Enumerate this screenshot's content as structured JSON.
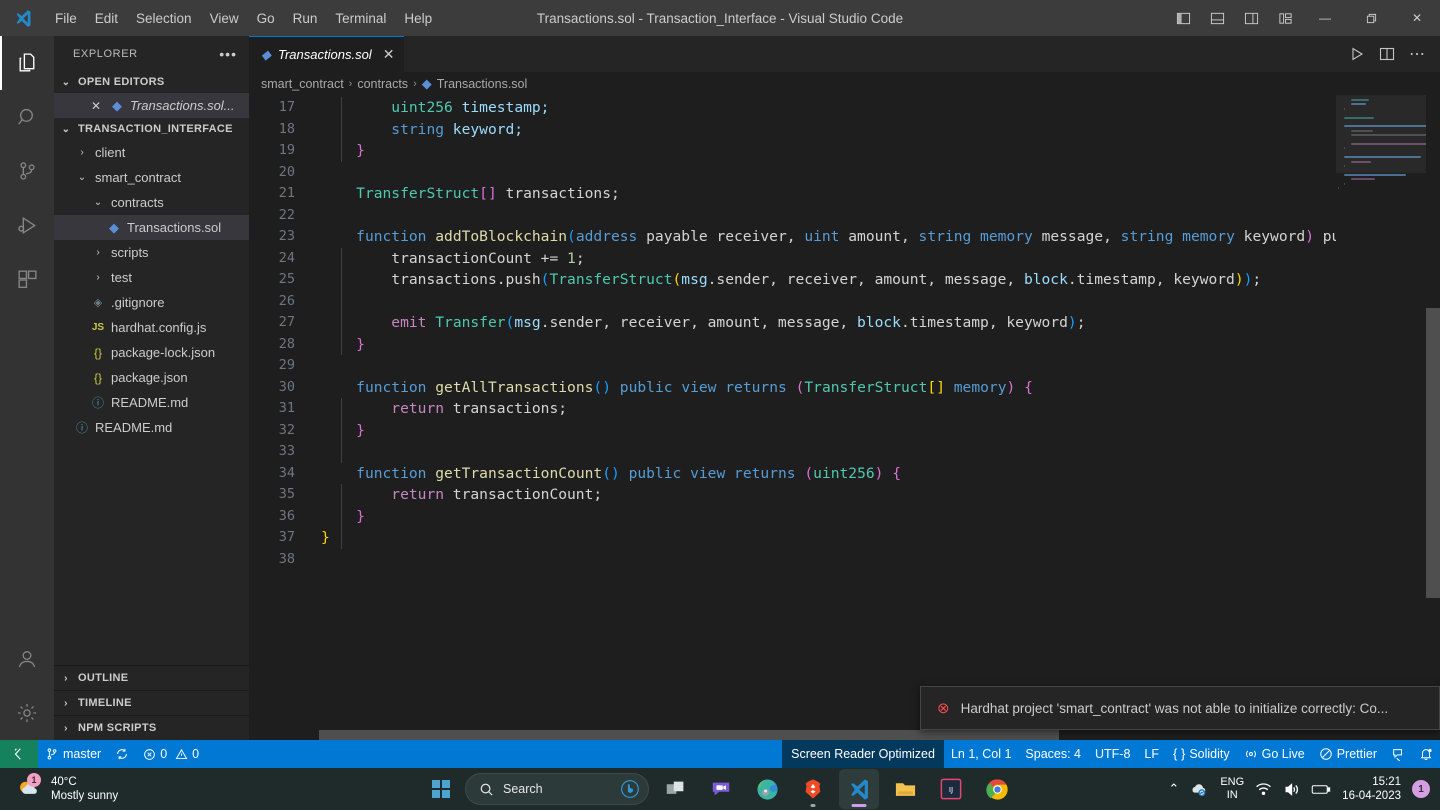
{
  "window": {
    "title": "Transactions.sol - Transaction_Interface - Visual Studio Code",
    "menus": [
      "File",
      "Edit",
      "Selection",
      "View",
      "Go",
      "Run",
      "Terminal",
      "Help"
    ],
    "layout_buttons": [
      "toggle-primary-sidebar",
      "toggle-panel",
      "toggle-secondary-sidebar",
      "customize-layout"
    ],
    "controls": {
      "minimize": "—",
      "restore": "❐",
      "close": "✕"
    }
  },
  "activity_bar": {
    "items": [
      {
        "name": "explorer",
        "icon": "files-icon",
        "active": true
      },
      {
        "name": "search",
        "icon": "search-icon",
        "active": false
      },
      {
        "name": "source-control",
        "icon": "source-control-icon",
        "active": false
      },
      {
        "name": "run-and-debug",
        "icon": "debug-icon",
        "active": false
      },
      {
        "name": "extensions",
        "icon": "extensions-icon",
        "active": false
      }
    ],
    "bottom": [
      {
        "name": "accounts",
        "icon": "account-icon"
      },
      {
        "name": "manage",
        "icon": "gear-icon"
      }
    ]
  },
  "sidebar": {
    "header": "EXPLORER",
    "more_actions": "•••",
    "open_editors": {
      "title": "OPEN EDITORS",
      "items": [
        {
          "label": "Transactions.sol...",
          "icon": "solidity-icon",
          "close": "✕",
          "selected": true
        }
      ]
    },
    "project": {
      "title": "TRANSACTION_INTERFACE",
      "items": [
        {
          "label": "client",
          "icon": "folder-icon",
          "type": "folder",
          "expanded": false,
          "indent": 1
        },
        {
          "label": "smart_contract",
          "icon": "folder-icon",
          "type": "folder",
          "expanded": true,
          "indent": 1
        },
        {
          "label": "contracts",
          "icon": "folder-icon",
          "type": "folder",
          "expanded": true,
          "indent": 2
        },
        {
          "label": "Transactions.sol",
          "icon": "solidity-icon",
          "type": "file",
          "selected": true,
          "indent": 3
        },
        {
          "label": "scripts",
          "icon": "folder-icon",
          "type": "folder",
          "expanded": false,
          "indent": 2
        },
        {
          "label": "test",
          "icon": "folder-icon",
          "type": "folder",
          "expanded": false,
          "indent": 2
        },
        {
          "label": ".gitignore",
          "icon": "gitignore-icon",
          "type": "file",
          "indent": 2
        },
        {
          "label": "hardhat.config.js",
          "icon": "js-icon",
          "type": "file",
          "indent": 2
        },
        {
          "label": "package-lock.json",
          "icon": "json-icon",
          "type": "file",
          "indent": 2
        },
        {
          "label": "package.json",
          "icon": "json-icon",
          "type": "file",
          "indent": 2
        },
        {
          "label": "README.md",
          "icon": "markdown-icon",
          "type": "file",
          "indent": 2
        },
        {
          "label": "README.md",
          "icon": "markdown-icon",
          "type": "file",
          "indent": 1
        }
      ]
    },
    "bottom_sections": [
      "OUTLINE",
      "TIMELINE",
      "NPM SCRIPTS"
    ]
  },
  "editor": {
    "tab": {
      "label": "Transactions.sol",
      "icon": "solidity-icon",
      "close": "✕",
      "dirty": false
    },
    "tab_actions": [
      "run-button",
      "split-editor-button",
      "more-actions-button"
    ],
    "breadcrumbs": [
      "smart_contract",
      "contracts",
      "Transactions.sol"
    ],
    "first_visible_line": 17,
    "lines": [
      {
        "n": 17,
        "indent": 8,
        "tokens": [
          {
            "t": "uint256",
            "c": "t-type"
          },
          {
            "t": " timestamp;",
            "c": "t-var"
          }
        ]
      },
      {
        "n": 18,
        "indent": 8,
        "tokens": [
          {
            "t": "string",
            "c": "t-kw"
          },
          {
            "t": " keyword;",
            "c": "t-var"
          }
        ]
      },
      {
        "n": 19,
        "indent": 4,
        "tokens": [
          {
            "t": "}",
            "c": "t-brk2"
          }
        ]
      },
      {
        "n": 20,
        "indent": 0,
        "tokens": []
      },
      {
        "n": 21,
        "indent": 4,
        "tokens": [
          {
            "t": "TransferStruct",
            "c": "t-type"
          },
          {
            "t": "[",
            "c": "t-brk2"
          },
          {
            "t": "]",
            "c": "t-brk2"
          },
          {
            "t": " transactions;",
            "c": "t-plain"
          }
        ]
      },
      {
        "n": 22,
        "indent": 0,
        "tokens": []
      },
      {
        "n": 23,
        "indent": 4,
        "tokens": [
          {
            "t": "function",
            "c": "t-kw"
          },
          {
            "t": " ",
            "c": "t-plain"
          },
          {
            "t": "addToBlockchain",
            "c": "t-fn"
          },
          {
            "t": "(",
            "c": "t-brk3"
          },
          {
            "t": "address",
            "c": "t-kw"
          },
          {
            "t": " payable",
            "c": "t-plain"
          },
          {
            "t": " receiver, ",
            "c": "t-plain"
          },
          {
            "t": "uint",
            "c": "t-kw"
          },
          {
            "t": " amount, ",
            "c": "t-plain"
          },
          {
            "t": "string",
            "c": "t-kw"
          },
          {
            "t": " memory",
            "c": "t-kw"
          },
          {
            "t": " message, ",
            "c": "t-plain"
          },
          {
            "t": "string",
            "c": "t-kw"
          },
          {
            "t": " memory",
            "c": "t-kw"
          },
          {
            "t": " keyword",
            "c": "t-plain"
          },
          {
            "t": ")",
            "c": "t-brk2"
          },
          {
            "t": " pub",
            "c": "t-plain"
          }
        ]
      },
      {
        "n": 24,
        "indent": 8,
        "tokens": [
          {
            "t": "transactionCount ",
            "c": "t-plain"
          },
          {
            "t": "+= ",
            "c": "t-plain"
          },
          {
            "t": "1",
            "c": "t-num"
          },
          {
            "t": ";",
            "c": "t-plain"
          }
        ]
      },
      {
        "n": 25,
        "indent": 8,
        "tokens": [
          {
            "t": "transactions",
            "c": "t-plain"
          },
          {
            "t": ".push",
            "c": "t-plain"
          },
          {
            "t": "(",
            "c": "t-brk3"
          },
          {
            "t": "TransferStruct",
            "c": "t-type"
          },
          {
            "t": "(",
            "c": "t-brk1"
          },
          {
            "t": "msg",
            "c": "t-var"
          },
          {
            "t": ".sender, receiver, amount, message, ",
            "c": "t-plain"
          },
          {
            "t": "block",
            "c": "t-var"
          },
          {
            "t": ".timestamp, keyword",
            "c": "t-plain"
          },
          {
            "t": ")",
            "c": "t-brk1"
          },
          {
            "t": ")",
            "c": "t-brk3"
          },
          {
            "t": ";",
            "c": "t-plain"
          }
        ]
      },
      {
        "n": 26,
        "indent": 0,
        "tokens": []
      },
      {
        "n": 27,
        "indent": 8,
        "tokens": [
          {
            "t": "emit",
            "c": "t-pur"
          },
          {
            "t": " ",
            "c": "t-plain"
          },
          {
            "t": "Transfer",
            "c": "t-type"
          },
          {
            "t": "(",
            "c": "t-brk3"
          },
          {
            "t": "msg",
            "c": "t-var"
          },
          {
            "t": ".sender, receiver, amount, message, ",
            "c": "t-plain"
          },
          {
            "t": "block",
            "c": "t-var"
          },
          {
            "t": ".timestamp, keyword",
            "c": "t-plain"
          },
          {
            "t": ")",
            "c": "t-brk3"
          },
          {
            "t": ";",
            "c": "t-plain"
          }
        ]
      },
      {
        "n": 28,
        "indent": 4,
        "tokens": [
          {
            "t": "}",
            "c": "t-brk2"
          }
        ]
      },
      {
        "n": 29,
        "indent": 0,
        "tokens": []
      },
      {
        "n": 30,
        "indent": 4,
        "tokens": [
          {
            "t": "function",
            "c": "t-kw"
          },
          {
            "t": " ",
            "c": "t-plain"
          },
          {
            "t": "getAllTransactions",
            "c": "t-fn"
          },
          {
            "t": "(",
            "c": "t-brk3"
          },
          {
            "t": ")",
            "c": "t-brk3"
          },
          {
            "t": " ",
            "c": "t-plain"
          },
          {
            "t": "public",
            "c": "t-kw"
          },
          {
            "t": " ",
            "c": "t-plain"
          },
          {
            "t": "view",
            "c": "t-kw"
          },
          {
            "t": " ",
            "c": "t-plain"
          },
          {
            "t": "returns",
            "c": "t-kw"
          },
          {
            "t": " ",
            "c": "t-plain"
          },
          {
            "t": "(",
            "c": "t-brk2"
          },
          {
            "t": "TransferStruct",
            "c": "t-type"
          },
          {
            "t": "[",
            "c": "t-brk1"
          },
          {
            "t": "]",
            "c": "t-brk1"
          },
          {
            "t": " memory",
            "c": "t-kw"
          },
          {
            "t": ")",
            "c": "t-brk2"
          },
          {
            "t": " ",
            "c": "t-plain"
          },
          {
            "t": "{",
            "c": "t-brk2"
          }
        ]
      },
      {
        "n": 31,
        "indent": 8,
        "tokens": [
          {
            "t": "return",
            "c": "t-pur"
          },
          {
            "t": " transactions;",
            "c": "t-plain"
          }
        ]
      },
      {
        "n": 32,
        "indent": 4,
        "tokens": [
          {
            "t": "}",
            "c": "t-brk2"
          }
        ]
      },
      {
        "n": 33,
        "indent": 0,
        "tokens": []
      },
      {
        "n": 34,
        "indent": 4,
        "tokens": [
          {
            "t": "function",
            "c": "t-kw"
          },
          {
            "t": " ",
            "c": "t-plain"
          },
          {
            "t": "getTransactionCount",
            "c": "t-fn"
          },
          {
            "t": "(",
            "c": "t-brk3"
          },
          {
            "t": ")",
            "c": "t-brk3"
          },
          {
            "t": " ",
            "c": "t-plain"
          },
          {
            "t": "public",
            "c": "t-kw"
          },
          {
            "t": " ",
            "c": "t-plain"
          },
          {
            "t": "view",
            "c": "t-kw"
          },
          {
            "t": " ",
            "c": "t-plain"
          },
          {
            "t": "returns",
            "c": "t-kw"
          },
          {
            "t": " ",
            "c": "t-plain"
          },
          {
            "t": "(",
            "c": "t-brk2"
          },
          {
            "t": "uint256",
            "c": "t-type"
          },
          {
            "t": ")",
            "c": "t-brk2"
          },
          {
            "t": " ",
            "c": "t-plain"
          },
          {
            "t": "{",
            "c": "t-brk2"
          }
        ]
      },
      {
        "n": 35,
        "indent": 8,
        "tokens": [
          {
            "t": "return",
            "c": "t-pur"
          },
          {
            "t": " transactionCount;",
            "c": "t-plain"
          }
        ]
      },
      {
        "n": 36,
        "indent": 4,
        "tokens": [
          {
            "t": "}",
            "c": "t-brk2"
          }
        ]
      },
      {
        "n": 37,
        "indent": 0,
        "tokens": [
          {
            "t": "}",
            "c": "t-brk1"
          }
        ]
      },
      {
        "n": 38,
        "indent": 0,
        "tokens": []
      }
    ]
  },
  "notification": {
    "icon": "error-icon",
    "message": "Hardhat project 'smart_contract' was not able to initialize correctly: Co..."
  },
  "status_bar": {
    "background": "#0078d4",
    "remote_indicator": {
      "icon": "remote-icon",
      "background": "#16825d"
    },
    "left": [
      {
        "name": "branch",
        "icon": "git-branch-icon",
        "label": "master"
      },
      {
        "name": "sync",
        "icon": "sync-icon",
        "label": ""
      },
      {
        "name": "problems",
        "icon": "error-warning-icon",
        "errors": "0",
        "warnings": "0"
      }
    ],
    "right": [
      {
        "name": "screen-reader",
        "label": "Screen Reader Optimized",
        "highlight": "#04395e"
      },
      {
        "name": "cursor-position",
        "label": "Ln 1, Col 1"
      },
      {
        "name": "indentation",
        "label": "Spaces: 4"
      },
      {
        "name": "encoding",
        "label": "UTF-8"
      },
      {
        "name": "eol",
        "label": "LF"
      },
      {
        "name": "language-mode",
        "label": "Solidity",
        "icon": "solidity-brackets-icon"
      },
      {
        "name": "go-live",
        "label": "Go Live",
        "icon": "broadcast-icon"
      },
      {
        "name": "prettier",
        "label": "Prettier",
        "icon": "prettier-check-icon"
      },
      {
        "name": "feedback",
        "label": "",
        "icon": "feedback-icon"
      },
      {
        "name": "notifications",
        "label": "",
        "icon": "bell-dot-icon"
      }
    ]
  },
  "taskbar": {
    "weather": {
      "temperature": "40°C",
      "condition": "Mostly sunny",
      "badge": "1"
    },
    "search_placeholder": "Search",
    "apps": [
      {
        "name": "task-view",
        "running": false
      },
      {
        "name": "teams-chat",
        "running": false
      },
      {
        "name": "microsoft-edge",
        "running": false
      },
      {
        "name": "brave-browser",
        "running": true,
        "dot": true
      },
      {
        "name": "visual-studio-code",
        "running": true,
        "active": true
      },
      {
        "name": "file-explorer",
        "running": false
      },
      {
        "name": "intellij-idea",
        "running": false
      },
      {
        "name": "google-chrome",
        "running": false
      }
    ],
    "tray": {
      "chevron": "⌃",
      "language": {
        "line1": "ENG",
        "line2": "IN"
      },
      "icons": [
        "cloud-sync-icon",
        "wifi-icon",
        "volume-icon",
        "battery-icon"
      ],
      "time": "15:21",
      "date": "16-04-2023",
      "notification_badge": "1"
    }
  }
}
